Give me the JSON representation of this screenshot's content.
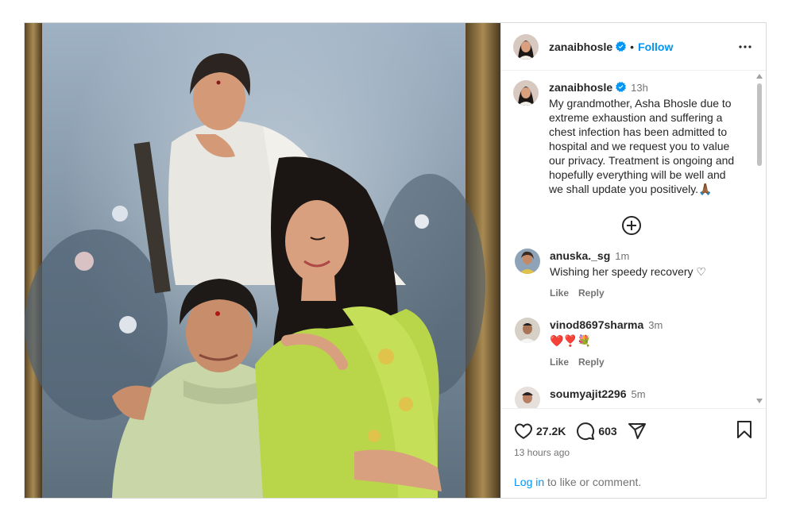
{
  "post": {
    "username": "zanaibhosle",
    "follow_label": "Follow",
    "separator": "•",
    "caption": {
      "username": "zanaibhosle",
      "time": "13h",
      "text": "My grandmother, Asha Bhosle due to extreme exhaustion and suffering  a chest infection has been admitted to hospital and we request you to value our privacy. Treatment is ongoing and hopefully everything will be well and we shall update you positively.🙏🏾"
    },
    "comments": [
      {
        "username": "anuska._sg",
        "time": "1m",
        "text": "Wishing her speedy recovery ♡",
        "like": "Like",
        "reply": "Reply"
      },
      {
        "username": "vinod8697sharma",
        "time": "3m",
        "text": "❤️❣️💐",
        "like": "Like",
        "reply": "Reply"
      },
      {
        "username": "soumyajit2296",
        "time": "5m"
      }
    ],
    "likes": "27.2K",
    "comment_count": "603",
    "posted_ago": "13 hours ago",
    "login_link": "Log in",
    "login_suffix": " to like or comment."
  },
  "icons": {
    "verified": "verified-badge-icon",
    "more": "more-options-icon",
    "add": "add-circle-icon",
    "like": "heart-icon",
    "comment": "comment-bubble-icon",
    "share": "paper-plane-icon",
    "save": "bookmark-icon"
  },
  "colors": {
    "accent": "#0095f6",
    "secondary_text": "#737373",
    "border": "#dbdbdb"
  }
}
